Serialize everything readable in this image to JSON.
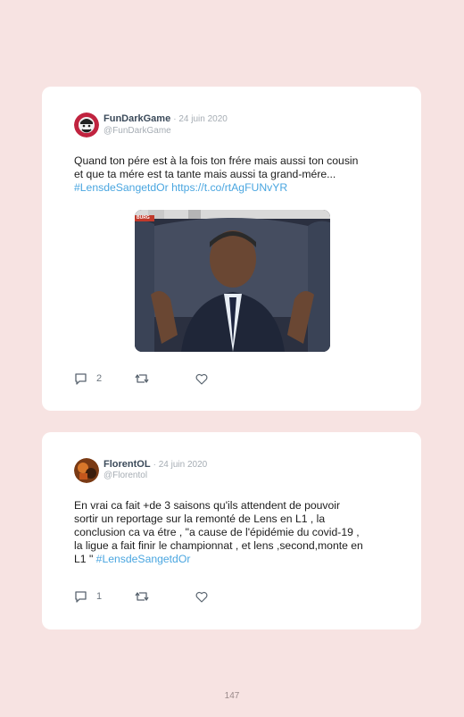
{
  "tweets": [
    {
      "author_name": "FunDarkGame",
      "date": "· 24 juin 2020",
      "handle": "@FunDarkGame",
      "text_lines": [
        "Quand ton pére est à la fois ton frére mais aussi ton cousin",
        "et que ta mére est ta tante mais aussi ta grand-mére..."
      ],
      "hashtag": "#LensdeSangetdOr",
      "url": "https://t.co/rtAgFUNvYR",
      "media_label": "BURG",
      "reply_count": "2",
      "avatar_color": "#c0233f",
      "icons": [
        "reply-icon",
        "retweet-icon",
        "like-icon"
      ]
    },
    {
      "author_name": "FlorentOL",
      "date": "· 24 juin 2020",
      "handle": "@Florentol",
      "text_lines": [
        "En vrai ca fait +de 3 saisons qu'ils attendent de pouvoir",
        "sortir un reportage sur la remonté de Lens en L1 , la",
        "conclusion ca va étre , \"a cause de l'épidémie du covid-19 ,",
        "la ligue a fait finir le championnat , et lens ,second,monte en",
        "L1 \""
      ],
      "hashtag": "#LensdeSangetdOr",
      "reply_count": "1",
      "avatar_color": "#7a3a14",
      "icons": [
        "reply-icon",
        "retweet-icon",
        "like-icon"
      ]
    }
  ],
  "page_number": "147",
  "colors": {
    "background": "#f7e3e2",
    "card": "#ffffff",
    "link": "#4aa6e0"
  }
}
